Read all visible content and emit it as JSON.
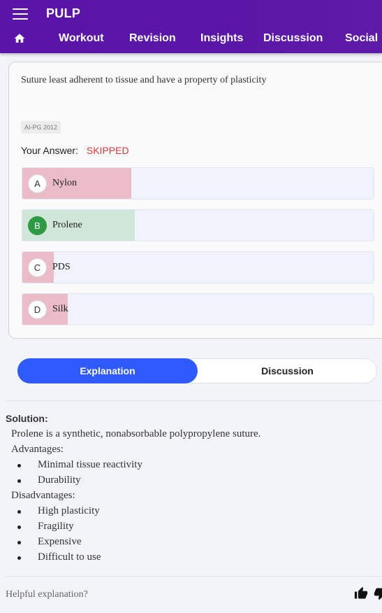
{
  "app": {
    "title": "PULP"
  },
  "nav": {
    "items": [
      "Workout",
      "Revision",
      "Insights",
      "Discussion",
      "Social"
    ]
  },
  "question": {
    "text": "Suture least adherent to tissue and have a property of plasticity",
    "tag": "AI-PG 2012",
    "answer_label": "Your Answer:",
    "answer_value": "SKIPPED",
    "options": [
      {
        "letter": "A",
        "text": "Nylon",
        "percent": 31,
        "state": "wrong"
      },
      {
        "letter": "B",
        "text": "Prolene",
        "percent": 32,
        "state": "correct"
      },
      {
        "letter": "C",
        "text": "PDS",
        "percent": 9,
        "state": "wrong"
      },
      {
        "letter": "D",
        "text": "Silk",
        "percent": 13,
        "state": "wrong"
      }
    ]
  },
  "tabs": {
    "explanation": "Explanation",
    "discussion": "Discussion"
  },
  "solution": {
    "heading": "Solution:",
    "intro": "Prolene is a synthetic, nonabsorbable polypropylene suture.",
    "advantages_label": "Advantages:",
    "advantages": [
      "Minimal tissue reactivity",
      "Durability"
    ],
    "disadvantages_label": "Disadvantages:",
    "disadvantages": [
      "High plasticity",
      "Fragility",
      "Expensive",
      "Difficult to use"
    ]
  },
  "feedback": {
    "prompt": "Helpful explanation?"
  },
  "colors": {
    "header": "#5a15a8",
    "accent": "#2f5bfd",
    "correct": "#2e9a43",
    "skipped": "#d63a3a"
  }
}
